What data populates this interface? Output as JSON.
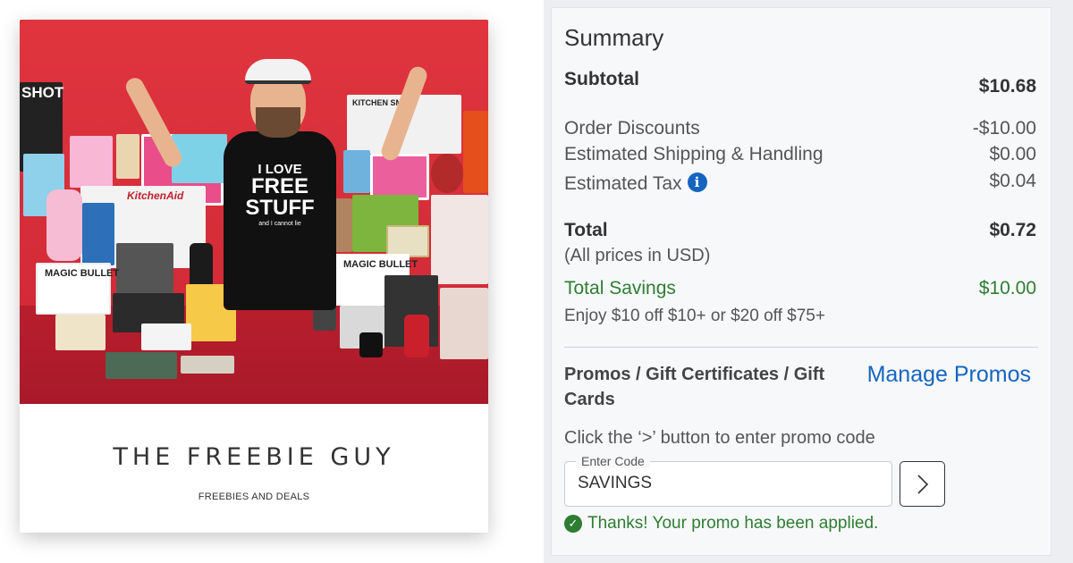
{
  "product_card": {
    "brand_title": "THE FREEBIE GUY",
    "brand_subtitle": "FREEBIES AND DEALS",
    "shirt_text": {
      "line1": "I LOVE",
      "line2": "FREE",
      "line3": "STUFF",
      "line4": "and I cannot lie"
    },
    "photo_box_labels": [
      "KitchenAid",
      "KITCHEN SMITH",
      "MAGIC BULLET",
      "MAGIC BULLET",
      "SHOT"
    ]
  },
  "summary": {
    "title": "Summary",
    "subtotal": {
      "label": "Subtotal",
      "value": "$10.68"
    },
    "order_discounts": {
      "label": "Order Discounts",
      "value": "-$10.00"
    },
    "shipping": {
      "label": "Estimated Shipping & Handling",
      "value": "$0.00"
    },
    "tax": {
      "label": "Estimated Tax",
      "value": "$0.04",
      "icon": "info-icon"
    },
    "total": {
      "label": "Total",
      "value": "$0.72",
      "note": "(All prices in USD)"
    },
    "savings": {
      "label": "Total Savings",
      "value": "$10.00"
    },
    "offer_text": "Enjoy $10 off $10+ or $20 off $75+"
  },
  "promos": {
    "label": "Promos / Gift Certificates / Gift Cards",
    "manage_link": "Manage Promos",
    "hint": "Click the ‘>’ button to enter promo code",
    "input_label": "Enter Code",
    "input_value": "SAVINGS",
    "submit_icon": "chevron-right-icon",
    "success_message": "Thanks! Your promo has been applied.",
    "success_icon": "check-circle-icon"
  },
  "colors": {
    "link_blue": "#1565c0",
    "success_green": "#2e7d32",
    "photo_red": "#d9303c"
  }
}
